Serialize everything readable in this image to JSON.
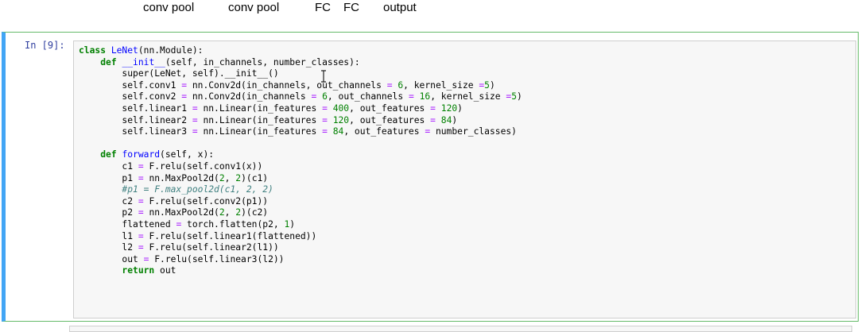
{
  "markdown_header": {
    "labels": [
      "conv pool",
      "conv pool",
      "FC",
      "FC",
      "output"
    ]
  },
  "cell": {
    "prompt": "In [9]:",
    "lines": [
      [
        [
          "kw",
          "class"
        ],
        [
          "t",
          " "
        ],
        [
          "fn",
          "LeNet"
        ],
        [
          "t",
          "(nn.Module):"
        ]
      ],
      [
        [
          "t",
          "    "
        ],
        [
          "kw",
          "def"
        ],
        [
          "t",
          " "
        ],
        [
          "mg",
          "__init__"
        ],
        [
          "t",
          "(self, in_channels, number_classes):"
        ]
      ],
      [
        [
          "t",
          "        super(LeNet, self)."
        ],
        [
          "t",
          "__init__"
        ],
        [
          "t",
          "()"
        ]
      ],
      [
        [
          "t",
          "        self.conv1 "
        ],
        [
          "op",
          "="
        ],
        [
          "t",
          " nn.Conv2d(in_channels, out_channels "
        ],
        [
          "op",
          "="
        ],
        [
          "t",
          " "
        ],
        [
          "num",
          "6"
        ],
        [
          "t",
          ", kernel_size "
        ],
        [
          "op",
          "="
        ],
        [
          "num",
          "5"
        ],
        [
          "t",
          ")"
        ]
      ],
      [
        [
          "t",
          "        self.conv2 "
        ],
        [
          "op",
          "="
        ],
        [
          "t",
          " nn.Conv2d(in_channels "
        ],
        [
          "op",
          "="
        ],
        [
          "t",
          " "
        ],
        [
          "num",
          "6"
        ],
        [
          "t",
          ", out_channels "
        ],
        [
          "op",
          "="
        ],
        [
          "t",
          " "
        ],
        [
          "num",
          "16"
        ],
        [
          "t",
          ", kernel_size "
        ],
        [
          "op",
          "="
        ],
        [
          "num",
          "5"
        ],
        [
          "t",
          ")"
        ]
      ],
      [
        [
          "t",
          "        self.linear1 "
        ],
        [
          "op",
          "="
        ],
        [
          "t",
          " nn.Linear(in_features "
        ],
        [
          "op",
          "="
        ],
        [
          "t",
          " "
        ],
        [
          "num",
          "400"
        ],
        [
          "t",
          ", out_features "
        ],
        [
          "op",
          "="
        ],
        [
          "t",
          " "
        ],
        [
          "num",
          "120"
        ],
        [
          "t",
          ")"
        ]
      ],
      [
        [
          "t",
          "        self.linear2 "
        ],
        [
          "op",
          "="
        ],
        [
          "t",
          " nn.Linear(in_features "
        ],
        [
          "op",
          "="
        ],
        [
          "t",
          " "
        ],
        [
          "num",
          "120"
        ],
        [
          "t",
          ", out_features "
        ],
        [
          "op",
          "="
        ],
        [
          "t",
          " "
        ],
        [
          "num",
          "84"
        ],
        [
          "t",
          ")"
        ]
      ],
      [
        [
          "t",
          "        self.linear3 "
        ],
        [
          "op",
          "="
        ],
        [
          "t",
          " nn.Linear(in_features "
        ],
        [
          "op",
          "="
        ],
        [
          "t",
          " "
        ],
        [
          "num",
          "84"
        ],
        [
          "t",
          ", out_features "
        ],
        [
          "op",
          "="
        ],
        [
          "t",
          " number_classes)"
        ]
      ],
      [
        [
          "t",
          ""
        ]
      ],
      [
        [
          "t",
          "    "
        ],
        [
          "kw",
          "def"
        ],
        [
          "t",
          " "
        ],
        [
          "fn",
          "forward"
        ],
        [
          "t",
          "(self, x):"
        ]
      ],
      [
        [
          "t",
          "        c1 "
        ],
        [
          "op",
          "="
        ],
        [
          "t",
          " F.relu(self.conv1(x))"
        ]
      ],
      [
        [
          "t",
          "        p1 "
        ],
        [
          "op",
          "="
        ],
        [
          "t",
          " nn.MaxPool2d("
        ],
        [
          "num",
          "2"
        ],
        [
          "t",
          ", "
        ],
        [
          "num",
          "2"
        ],
        [
          "t",
          ")(c1)"
        ]
      ],
      [
        [
          "t",
          "        "
        ],
        [
          "cm",
          "#p1 = F.max_pool2d(c1, 2, 2)"
        ]
      ],
      [
        [
          "t",
          "        c2 "
        ],
        [
          "op",
          "="
        ],
        [
          "t",
          " F.relu(self.conv2(p1))"
        ]
      ],
      [
        [
          "t",
          "        p2 "
        ],
        [
          "op",
          "="
        ],
        [
          "t",
          " nn.MaxPool2d("
        ],
        [
          "num",
          "2"
        ],
        [
          "t",
          ", "
        ],
        [
          "num",
          "2"
        ],
        [
          "t",
          ")(c2)"
        ]
      ],
      [
        [
          "t",
          "        flattened "
        ],
        [
          "op",
          "="
        ],
        [
          "t",
          " torch.flatten(p2, "
        ],
        [
          "num",
          "1"
        ],
        [
          "t",
          ")"
        ]
      ],
      [
        [
          "t",
          "        l1 "
        ],
        [
          "op",
          "="
        ],
        [
          "t",
          " F.relu(self.linear1(flattened))"
        ]
      ],
      [
        [
          "t",
          "        l2 "
        ],
        [
          "op",
          "="
        ],
        [
          "t",
          " F.relu(self.linear2(l1))"
        ]
      ],
      [
        [
          "t",
          "        out "
        ],
        [
          "op",
          "="
        ],
        [
          "t",
          " F.relu(self.linear3(l2))"
        ]
      ],
      [
        [
          "t",
          "        "
        ],
        [
          "kw",
          "return"
        ],
        [
          "t",
          " out"
        ]
      ]
    ]
  },
  "colors": {
    "keyword": "#008000",
    "function_name": "#0000ff",
    "number": "#008000",
    "operator": "#aa22ff",
    "comment": "#408080",
    "prompt": "#303f9f",
    "cell_border_selected": "#66bb6a",
    "cell_left_bar": "#42a5f5"
  },
  "icons": {
    "text_cursor": "text-cursor-icon"
  }
}
